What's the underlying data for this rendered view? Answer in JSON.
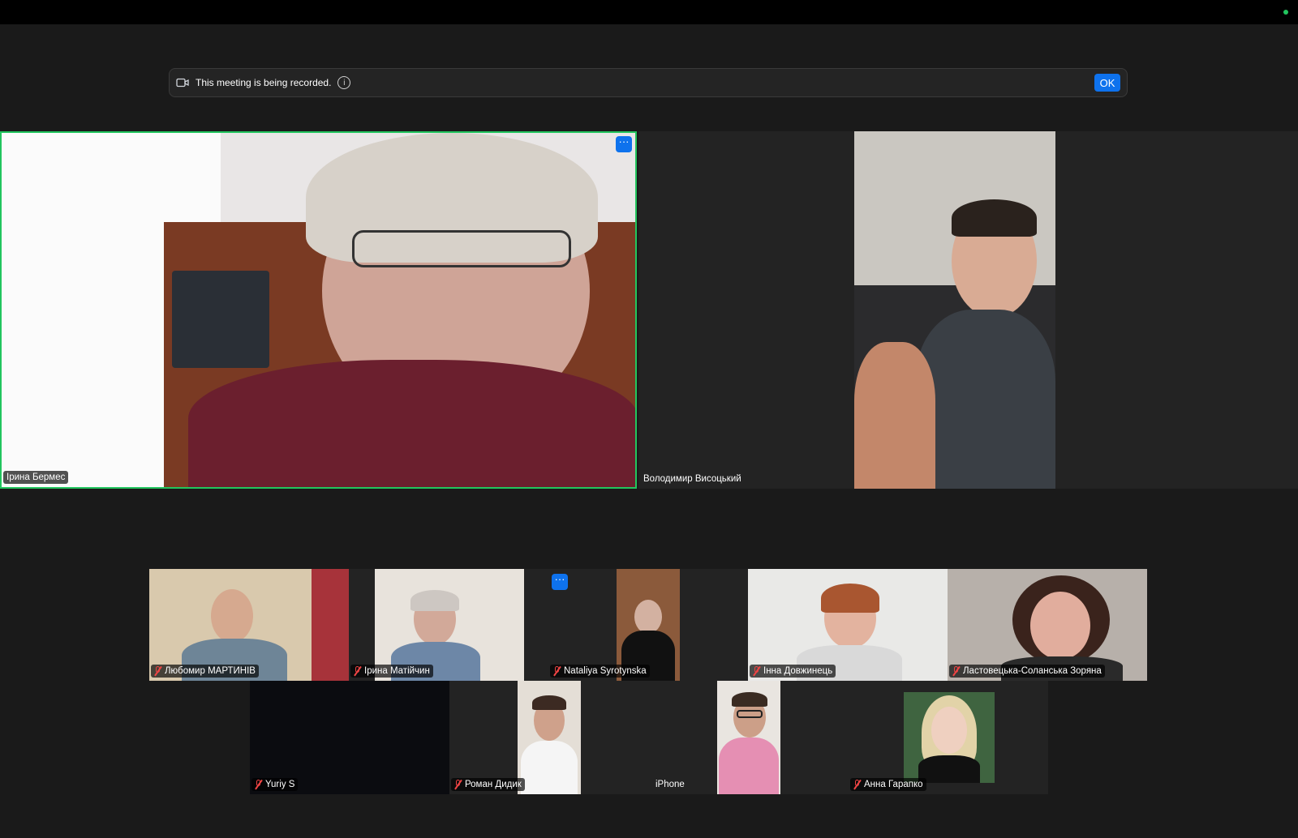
{
  "notice": {
    "text": "This meeting is being recorded.",
    "ok_label": "OK"
  },
  "featured": [
    {
      "name": "Ірина Бермес",
      "muted": false,
      "active_speaker": true
    },
    {
      "name": "Володимир Висоцький",
      "muted": false,
      "active_speaker": false
    }
  ],
  "gallery_row1": [
    {
      "name": "Любомир МАРТИНІВ",
      "muted": true
    },
    {
      "name": "Ірина Матійчин",
      "muted": true
    },
    {
      "name": "Nataliya Syrotynska",
      "muted": true
    },
    {
      "name": "Інна Довжинець",
      "muted": true
    },
    {
      "name": "Ластовецька-Соланська Зоряна",
      "muted": true
    }
  ],
  "gallery_row2": [
    {
      "name": "Yuriy S",
      "muted": true
    },
    {
      "name": "Роман Дидик",
      "muted": true
    },
    {
      "name": "iPhone",
      "muted": false
    },
    {
      "name": "Анна Гарапко",
      "muted": true
    }
  ],
  "colors": {
    "accent": "#0e72ed",
    "active_speaker_border": "#22c55e",
    "mute": "#ef4444"
  }
}
